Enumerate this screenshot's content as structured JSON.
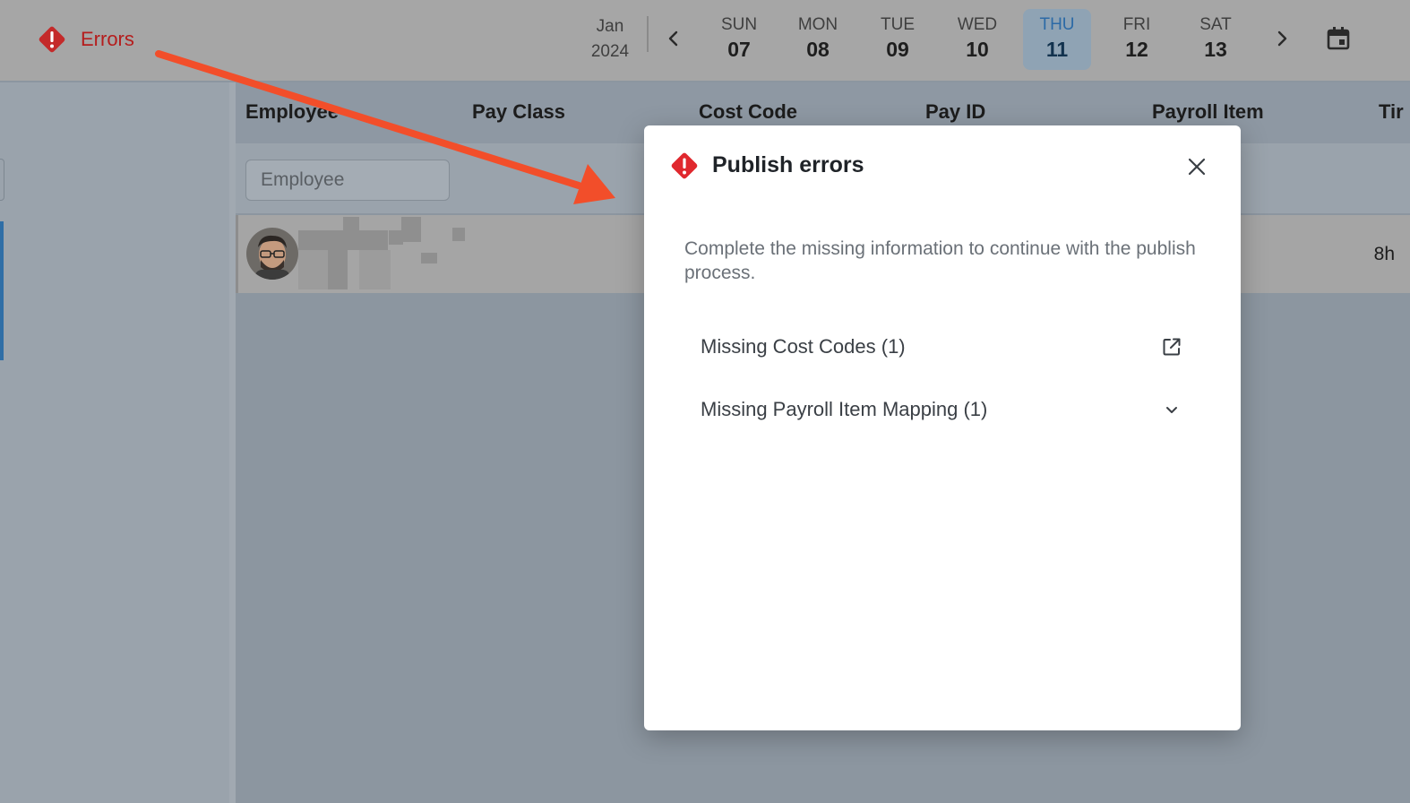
{
  "header": {
    "errors_label": "Errors",
    "month": "Jan",
    "year": "2024",
    "days": [
      {
        "name": "SUN",
        "num": "07"
      },
      {
        "name": "MON",
        "num": "08"
      },
      {
        "name": "TUE",
        "num": "09"
      },
      {
        "name": "WED",
        "num": "10"
      },
      {
        "name": "THU",
        "num": "11"
      },
      {
        "name": "FRI",
        "num": "12"
      },
      {
        "name": "SAT",
        "num": "13"
      }
    ],
    "selected_day": "THU"
  },
  "table": {
    "columns": [
      "Employee",
      "Pay Class",
      "Cost Code",
      "Pay ID",
      "Payroll Item",
      "Tir"
    ],
    "filter_placeholder": "Employee",
    "rows": [
      {
        "hours": "8h"
      }
    ]
  },
  "modal": {
    "title": "Publish errors",
    "description": "Complete the missing information to continue with the publish process.",
    "items": [
      {
        "label": "Missing Cost Codes (1)",
        "icon": "external-link-icon"
      },
      {
        "label": "Missing Payroll Item Mapping (1)",
        "icon": "chevron-down-icon"
      }
    ]
  },
  "colors": {
    "error_red": "#e0282e",
    "annotation_arrow": "#f24e2a",
    "selected_day_bg": "#8fa3b4",
    "error_text": "#b51d1d"
  }
}
